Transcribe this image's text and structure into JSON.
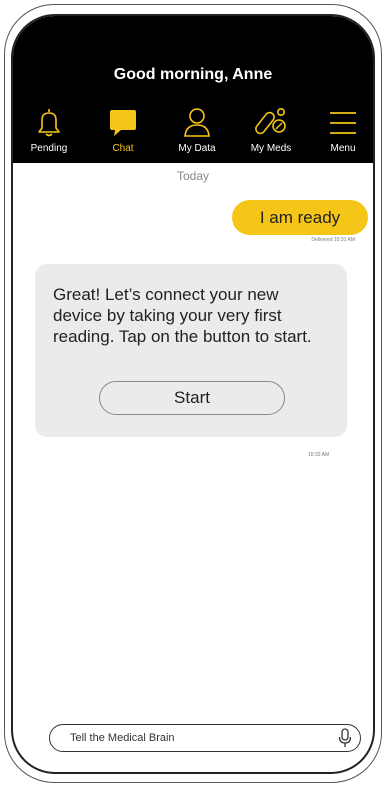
{
  "header": {
    "greeting": "Good morning, Anne"
  },
  "nav": {
    "items": [
      {
        "label": "Pending",
        "icon": "bell-icon"
      },
      {
        "label": "Chat",
        "icon": "chat-bubble-icon",
        "active": true
      },
      {
        "label": "My Data",
        "icon": "person-icon"
      },
      {
        "label": "My Meds",
        "icon": "pill-icon"
      },
      {
        "label": "Menu",
        "icon": "hamburger-menu-icon"
      }
    ]
  },
  "chat": {
    "date": "Today",
    "user_message": "I am ready",
    "user_status": "Delivered 10:31 AM",
    "bot_message": "Great! Let’s connect your new device by taking your very first reading. Tap on the button to start.",
    "bot_button": "Start",
    "bot_time": "10:32 AM"
  },
  "input": {
    "placeholder": "Tell the Medical Brain",
    "mic_icon": "microphone-icon"
  },
  "colors": {
    "accent": "#f5c518",
    "header_bg": "#000000",
    "bot_bubble": "#ebebeb"
  }
}
